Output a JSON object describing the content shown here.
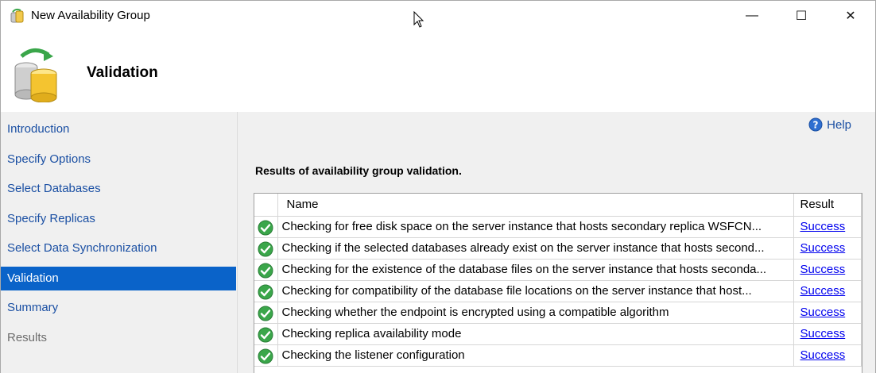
{
  "window": {
    "title": "New Availability Group",
    "minimize_symbol": "—",
    "maximize_symbol": "☐",
    "close_symbol": "✕"
  },
  "header": {
    "title": "Validation",
    "icon": "database-sync-icon"
  },
  "nav": {
    "items": [
      {
        "label": "Introduction",
        "state": "link"
      },
      {
        "label": "Specify Options",
        "state": "link"
      },
      {
        "label": "Select Databases",
        "state": "link"
      },
      {
        "label": "Specify Replicas",
        "state": "link"
      },
      {
        "label": "Select Data Synchronization",
        "state": "link"
      },
      {
        "label": "Validation",
        "state": "active"
      },
      {
        "label": "Summary",
        "state": "link"
      },
      {
        "label": "Results",
        "state": "disabled"
      }
    ]
  },
  "main": {
    "help_label": "Help",
    "results_heading": "Results of availability group validation.",
    "table": {
      "columns": [
        "Name",
        "Result"
      ],
      "rows": [
        {
          "icon": "success-check-icon",
          "name": "Checking for free disk space on the server instance that hosts secondary replica WSFCN...",
          "result": "Success"
        },
        {
          "icon": "success-check-icon",
          "name": "Checking if the selected databases already exist on the server instance that hosts second...",
          "result": "Success"
        },
        {
          "icon": "success-check-icon",
          "name": "Checking for the existence of the database files on the server instance that hosts seconda...",
          "result": "Success"
        },
        {
          "icon": "success-check-icon",
          "name": "Checking for compatibility of the database file locations on the server instance that host...",
          "result": "Success"
        },
        {
          "icon": "success-check-icon",
          "name": "Checking whether the endpoint is encrypted using a compatible algorithm",
          "result": "Success"
        },
        {
          "icon": "success-check-icon",
          "name": "Checking replica availability mode",
          "result": "Success"
        },
        {
          "icon": "success-check-icon",
          "name": "Checking the listener configuration",
          "result": "Success"
        }
      ]
    }
  },
  "colors": {
    "nav_active_bg": "#0a63c9",
    "link": "#1a4fa3",
    "success_link": "#0000ee",
    "panel_bg": "#f0f0f0",
    "check_green": "#3aa64a"
  }
}
